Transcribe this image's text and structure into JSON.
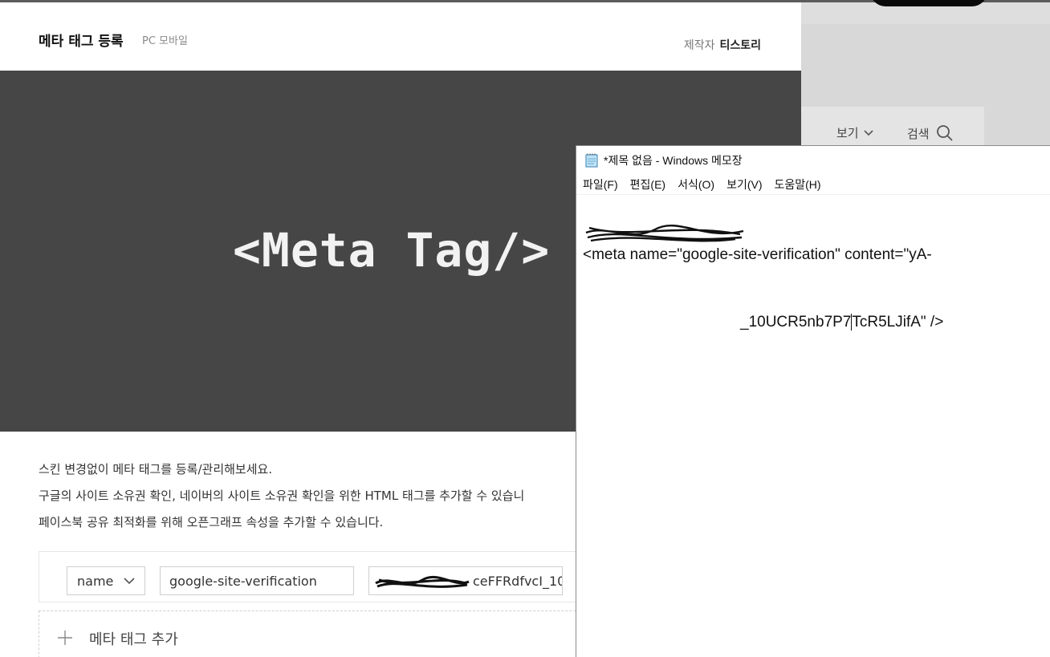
{
  "modal": {
    "title": "메타 태그 등록",
    "subtitle": "PC 모바일",
    "author_label": "제작자",
    "author_name": "티스토리",
    "hero_text": "<Meta Tag/>",
    "description": [
      "스킨 변경없이 메타 태그를 등록/관리해보세요.",
      "구글의 사이트 소유권 확인, 네이버의 사이트 소유권 확인을 위한 HTML 태그를 추가할 수 있습니",
      "페이스북 공유 최적화를 위해 오픈그래프 속성을 추가할 수 있습니다."
    ],
    "tag_row": {
      "type_value": "name",
      "name_value": "google-site-verification",
      "content_value_visible": "ceFFRdfvcI_10"
    },
    "add_label": "메타 태그 추가"
  },
  "background": {
    "view_label": "보기",
    "search_label": "검색"
  },
  "notepad": {
    "title": "*제목 없음 - Windows 메모장",
    "menu": [
      "파일(F)",
      "편집(E)",
      "서식(O)",
      "보기(V)",
      "도움말(H)"
    ],
    "line1": "<meta name=\"google-site-verification\" content=\"yA-",
    "line2_visible_start": "_10UCR5nb7P7",
    "line2_visible_end": "TcR5LJifA\" />"
  },
  "colors": {
    "hero_bg": "#464646",
    "overlay_bg": "#5c5c5c"
  }
}
